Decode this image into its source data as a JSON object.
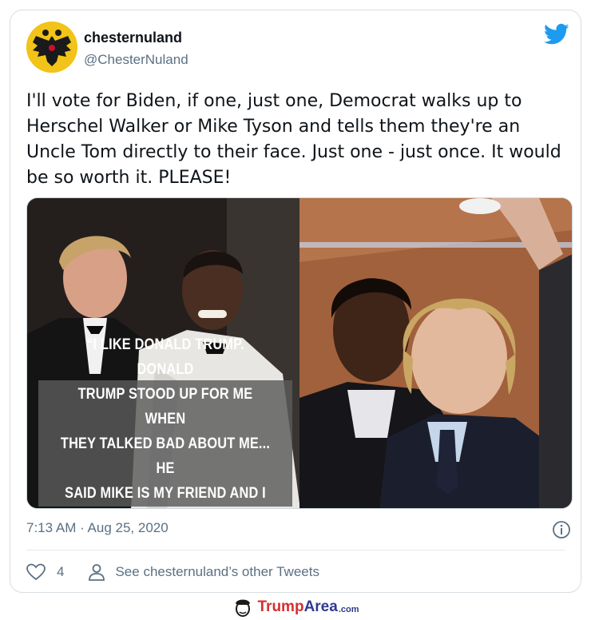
{
  "tweet": {
    "display_name": "chesternuland",
    "handle": "@ChesterNuland",
    "text": "I'll vote for Biden, if one, just one, Democrat walks up to Herschel Walker or Mike Tyson and tells them they're an Uncle Tom directly to their face. Just one - just once. It would be so worth it. PLEASE!",
    "timestamp": "7:13 AM · Aug 25, 2020",
    "like_count": "4",
    "other_tweets_link": "See chesternuland’s other Tweets"
  },
  "media": {
    "quote": "“I LIKE DONALD TRUMP. DONALD\nTRUMP STOOD UP FOR ME WHEN\nTHEY TALKED BAD ABOUT ME... HE\nSAID MIKE IS MY FRIEND AND I\nRESPECTED THAT.” - MIKE TYSON"
  },
  "footer": {
    "brand_part1": "Trump",
    "brand_part2": "Area",
    "brand_part3": ".com"
  },
  "icons": {
    "avatar": "eagle-crest-icon",
    "brand": "twitter-bird-icon",
    "info": "info-icon",
    "like": "heart-icon",
    "profile": "person-icon"
  },
  "colors": {
    "twitter_blue": "#1d9bf0",
    "secondary_text": "#5b7083",
    "brand_red": "#d32f2f",
    "brand_blue": "#2f3a8f"
  }
}
